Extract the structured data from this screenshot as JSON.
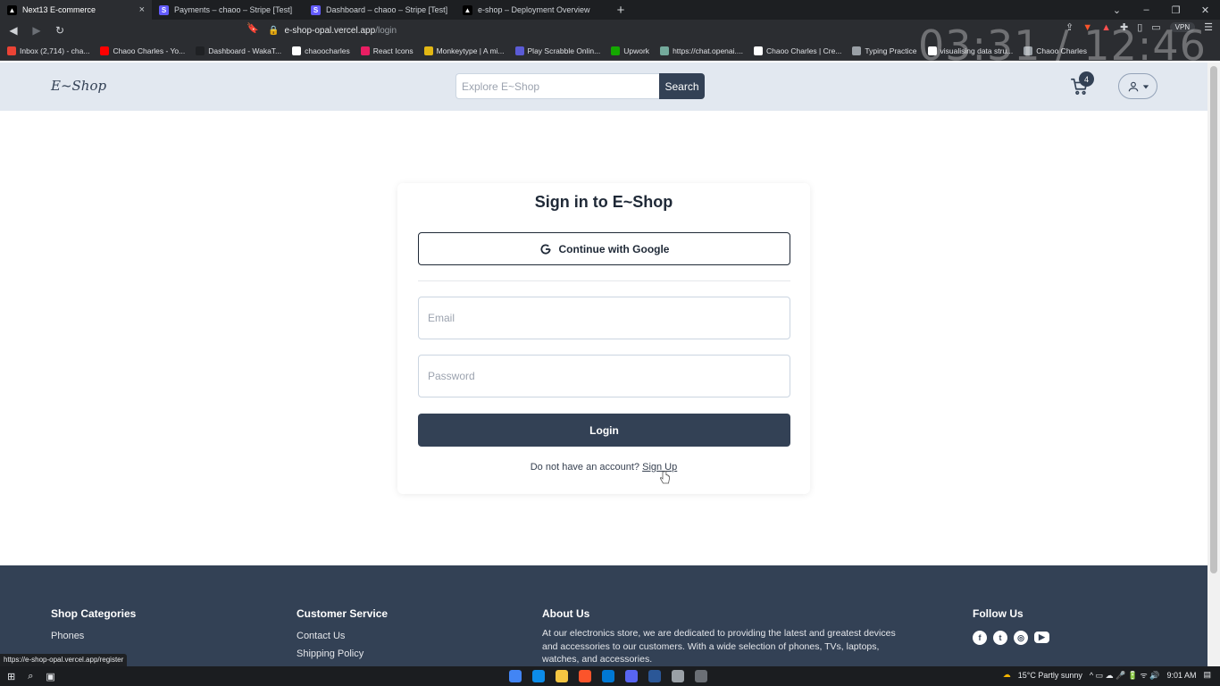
{
  "browser": {
    "tabs": [
      {
        "title": "Next13 E-commerce",
        "active": true
      },
      {
        "title": "Payments – chaoo – Stripe [Test]",
        "active": false
      },
      {
        "title": "Dashboard – chaoo – Stripe [Test]",
        "active": false
      },
      {
        "title": "e-shop – Deployment Overview",
        "active": false
      }
    ],
    "new_tab": "+",
    "url_host": "e-shop-opal.vercel.app",
    "url_path": "/login",
    "vpn_label": "VPN",
    "overlay_time": "03:31 / 12:46",
    "bookmarks": [
      {
        "label": "Inbox (2,714) - cha...",
        "color": "#ea4335"
      },
      {
        "label": "Chaoo Charles - Yo...",
        "color": "#ff0000"
      },
      {
        "label": "Dashboard - WakaT...",
        "color": "#1f2124"
      },
      {
        "label": "chaoocharles",
        "color": "#ffffff"
      },
      {
        "label": "React Icons",
        "color": "#e91e63"
      },
      {
        "label": "Monkeytype | A mi...",
        "color": "#e2b714"
      },
      {
        "label": "Play Scrabble Onlin...",
        "color": "#5b5bd6"
      },
      {
        "label": "Upwork",
        "color": "#14a800"
      },
      {
        "label": "https://chat.openai....",
        "color": "#74aa9c"
      },
      {
        "label": "Chaoo Charles | Cre...",
        "color": "#ffffff"
      },
      {
        "label": "Typing Practice",
        "color": "#9aa0a6"
      },
      {
        "label": "visualising data stru...",
        "color": "#ffffff"
      },
      {
        "label": "Chaoo Charles",
        "color": "#9aa0a6"
      }
    ],
    "status_url": "https://e-shop-opal.vercel.app/register"
  },
  "header": {
    "logo": "E~Shop",
    "search_placeholder": "Explore E~Shop",
    "search_button": "Search",
    "cart_count": "4"
  },
  "login": {
    "title": "Sign in to E~Shop",
    "google_button": "Continue with Google",
    "email_placeholder": "Email",
    "password_placeholder": "Password",
    "login_button": "Login",
    "no_account_text": "Do not have an account?",
    "signup_link": "Sign Up"
  },
  "footer": {
    "categories_heading": "Shop Categories",
    "categories": [
      "Phones"
    ],
    "service_heading": "Customer Service",
    "service_links": [
      "Contact Us",
      "Shipping Policy"
    ],
    "about_heading": "About Us",
    "about_text": "At our electronics store, we are dedicated to providing the latest and greatest devices and accessories to our customers. With a wide selection of phones, TVs, laptops, watches, and accessories.",
    "follow_heading": "Follow Us"
  },
  "taskbar": {
    "weather": "15°C  Partly sunny",
    "time": "9:01 AM"
  },
  "colors": {
    "header_bg": "#e2e8f0",
    "primary": "#334155",
    "footer_bg": "#334155"
  }
}
